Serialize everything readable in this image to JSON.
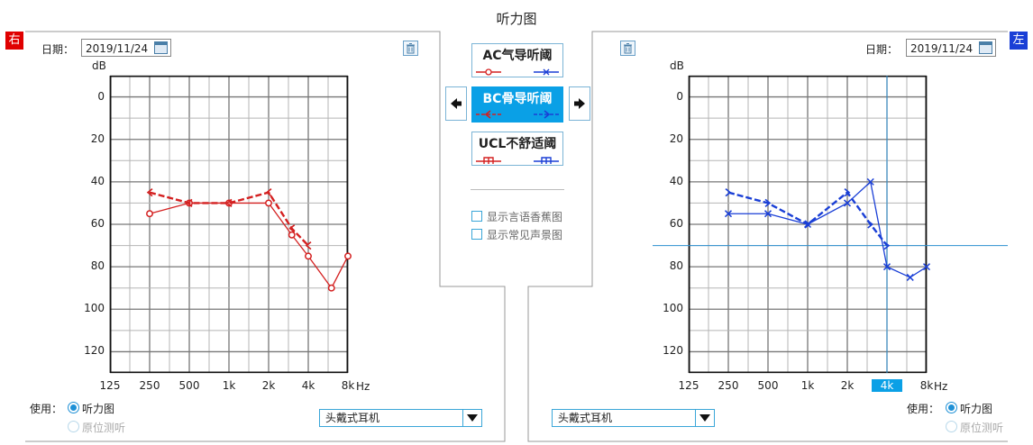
{
  "title": "听力图",
  "right_ear": {
    "badge": "右",
    "badge_color": "#e00000",
    "date_label": "日期：",
    "date_value": "2019/11/24",
    "use_label": "使用：",
    "radio_audiogram": "听力图",
    "radio_insitu": "原位测听",
    "transducer": "头戴式耳机",
    "series_color": "#d42020"
  },
  "left_ear": {
    "badge": "左",
    "badge_color": "#1a3fd6",
    "date_label": "日期：",
    "date_value": "2019/11/24",
    "use_label": "使用：",
    "radio_audiogram": "听力图",
    "radio_insitu": "原位测听",
    "transducer": "头戴式耳机",
    "series_color": "#1a3fd6"
  },
  "center_panel": {
    "ac_label": "AC气导听阈",
    "bc_label": "BC骨导听阈",
    "ucl_label": "UCL不舒适阈",
    "prev_icon": "arrow-left-icon",
    "next_icon": "arrow-right-icon",
    "show_speech_banana": "显示言语香蕉图",
    "show_familiar_sounds": "显示常见声景图"
  },
  "axis": {
    "y_unit": "dB",
    "x_unit": "Hz",
    "y_ticks": [
      "0",
      "20",
      "40",
      "60",
      "80",
      "100",
      "120"
    ],
    "x_ticks": [
      "125",
      "250",
      "500",
      "1k",
      "2k",
      "4k",
      "8k"
    ],
    "highlight_x_left": "4k"
  },
  "chart_data": [
    {
      "type": "line",
      "title": "",
      "ear": "right",
      "ylabel": "dB",
      "xlabel": "Hz",
      "ylim": [
        -10,
        130
      ],
      "x_scale": "log",
      "xlim": [
        125,
        10000
      ],
      "series": [
        {
          "marker": "circle",
          "style": "solid",
          "x": [
            250,
            500,
            1000,
            2000,
            3000,
            4000,
            6000,
            8000
          ],
          "y": [
            55,
            50,
            50,
            50,
            65,
            75,
            90,
            75
          ]
        },
        {
          "marker": "bone-bracket",
          "style": "dashed",
          "x": [
            250,
            500,
            1000,
            2000,
            3000,
            4000
          ],
          "y": [
            45,
            50,
            50,
            45,
            62,
            70
          ]
        }
      ]
    },
    {
      "type": "line",
      "title": "",
      "ear": "left",
      "ylabel": "dB",
      "xlabel": "Hz",
      "ylim": [
        -10,
        130
      ],
      "x_scale": "log",
      "xlim": [
        125,
        10000
      ],
      "crosshair": {
        "x": 4000,
        "y": 70
      },
      "series": [
        {
          "marker": "x",
          "style": "solid",
          "x": [
            250,
            500,
            1000,
            2000,
            3000,
            4000,
            6000,
            8000
          ],
          "y": [
            55,
            55,
            60,
            50,
            40,
            80,
            85,
            80
          ]
        },
        {
          "marker": "bone-bracket",
          "style": "dashed",
          "x": [
            250,
            500,
            1000,
            2000,
            3000,
            4000
          ],
          "y": [
            45,
            50,
            60,
            45,
            60,
            70
          ]
        }
      ]
    }
  ]
}
